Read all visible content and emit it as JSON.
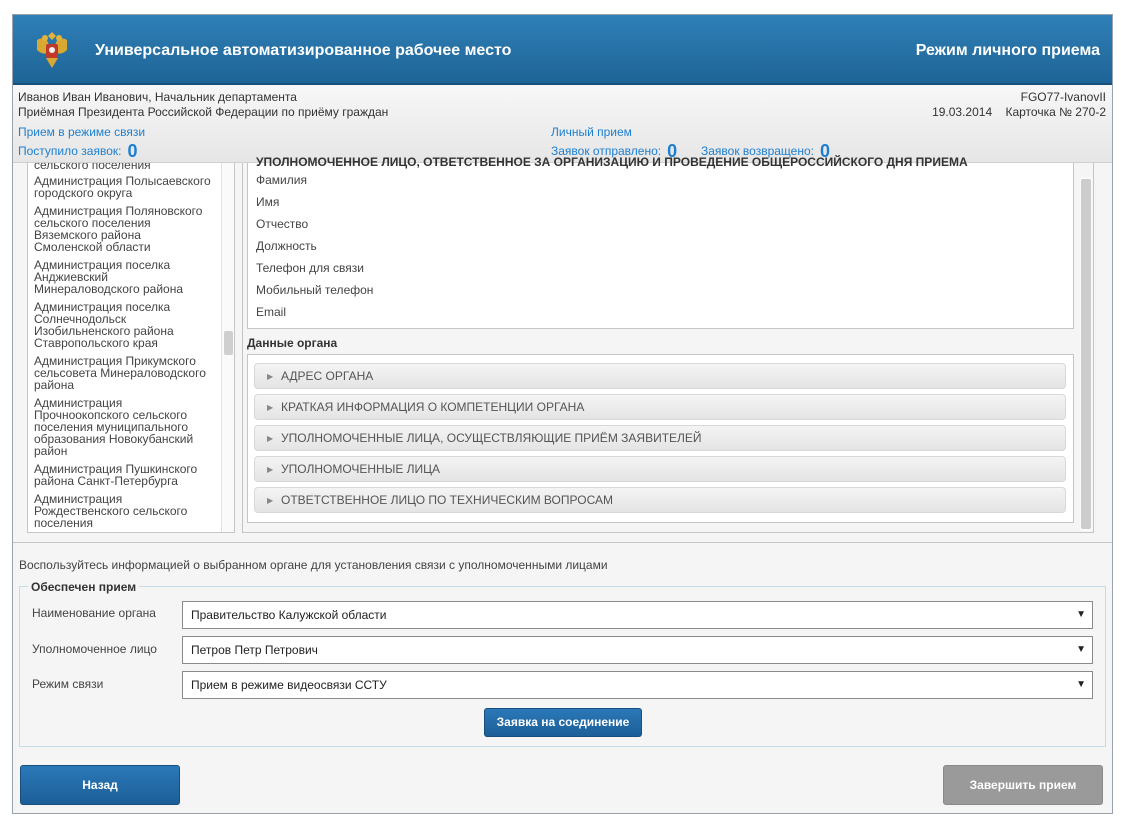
{
  "header": {
    "app_title": "Универсальное автоматизированное рабочее место",
    "mode_title": "Режим личного приема",
    "emblem_icon": "coat-of-arms-icon"
  },
  "infobar": {
    "user_line": "Иванов Иван Иванович, Начальник департамента",
    "org_line": "Приёмная Президента Российской Федерации по приёму граждан",
    "login": "FGO77-IvanovII",
    "date": "19.03.2014",
    "card": "Карточка № 270-2",
    "comm_mode_label": "Прием в режиме связи",
    "received_label": "Поступило заявок:",
    "received_count": "0",
    "personal_label": "Личный прием",
    "sent_label": "Заявок отправлено:",
    "sent_count": "0",
    "returned_label": "Заявок возвращено:",
    "returned_count": "0"
  },
  "left_list": {
    "items": [
      [
        "сельского поселения"
      ],
      [
        "Администрация Полысаевского",
        "городского округа"
      ],
      [
        "Администрация Поляновского",
        "сельского поселения",
        "Вяземского района",
        "Смоленской области"
      ],
      [
        "Администрация поселка",
        "Анджиевский",
        "Минераловодского района"
      ],
      [
        "Администрация поселка",
        "Солнечнодольск",
        "Изобильненского района",
        "Ставропольского края"
      ],
      [
        "Администрация Прикумского",
        "сельсовета Минераловодского",
        "района"
      ],
      [
        "Администрация",
        "Прочноокопского сельского",
        "поселения муниципального",
        "образования Новокубанский",
        "район"
      ],
      [
        "Администрация Пушкинского",
        "района Санкт-Петербурга"
      ],
      [
        "Администрация",
        "Рождественского сельского",
        "поселения"
      ]
    ]
  },
  "contact": {
    "cut_heading": "УПОЛНОМОЧЕННОЕ ЛИЦО, ОТВЕТСТВЕННОЕ ЗА ОРГАНИЗАЦИЮ И ПРОВЕДЕНИЕ ОБЩЕРОССИЙСКОГО ДНЯ ПРИЕМА",
    "fields": [
      "Фамилия",
      "Имя",
      "Отчество",
      "Должность",
      "Телефон для связи",
      "Мобильный телефон",
      "Email"
    ]
  },
  "organ": {
    "title": "Данные органа",
    "sections": [
      "АДРЕС ОРГАНА",
      "КРАТКАЯ ИНФОРМАЦИЯ О КОМПЕТЕНЦИИ ОРГАНА",
      "УПОЛНОМОЧЕННЫЕ ЛИЦА, ОСУЩЕСТВЛЯЮЩИЕ ПРИЁМ ЗАЯВИТЕЛЕЙ",
      "УПОЛНОМОЧЕННЫЕ ЛИЦА",
      "ОТВЕТСТВЕННОЕ ЛИЦО ПО ТЕХНИЧЕСКИМ ВОПРОСАМ"
    ]
  },
  "hint": "Воспользуйтесь информацией о выбранном органе для установления связи с уполномоченными лицами",
  "form": {
    "legend": "Обеспечен прием",
    "organ_label": "Наименование органа",
    "organ_value": "Правительство Калужской области",
    "person_label": "Уполномоченное лицо",
    "person_value": "Петров Петр Петрович",
    "mode_label": "Режим связи",
    "mode_value": "Прием в режиме видеосвязи ССТУ",
    "connect_button": "Заявка на соединение"
  },
  "footer": {
    "back_button": "Назад",
    "finish_button": "Завершить прием"
  },
  "colors": {
    "header_blue": "#1e6496",
    "accent_blue": "#1e7fd0",
    "button_blue": "#1c5f98",
    "button_gray": "#9a9a9a"
  }
}
